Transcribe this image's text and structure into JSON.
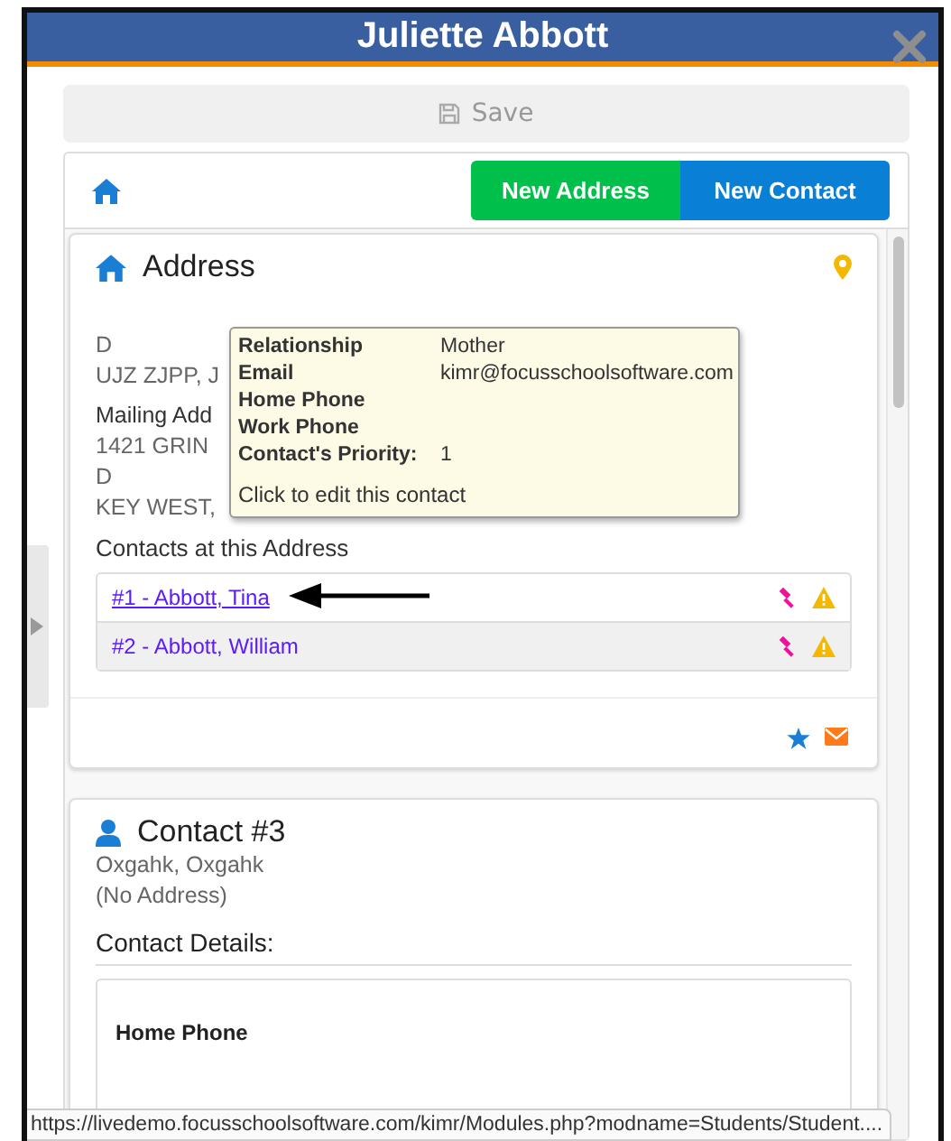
{
  "window": {
    "title": "Juliette Abbott"
  },
  "save_button": {
    "label": "Save",
    "disabled": true
  },
  "toolbar": {
    "buttons": [
      {
        "label": "New Address",
        "kind": "address"
      },
      {
        "label": "New Contact",
        "kind": "contact"
      }
    ]
  },
  "address_card": {
    "title": "Address",
    "lines": [
      {
        "text": "D",
        "kind": "detail"
      },
      {
        "text": "UJZ ZJPP, J",
        "kind": "detail"
      },
      {
        "text": "Mailing Add",
        "kind": "label"
      },
      {
        "text": "1421 GRIN",
        "kind": "detail"
      },
      {
        "text": "D",
        "kind": "detail"
      },
      {
        "text": "KEY WEST,",
        "kind": "detail"
      }
    ],
    "contacts_heading": "Contacts at this Address",
    "contacts": [
      {
        "label": "#1 - Abbott, Tina",
        "hovered": true
      },
      {
        "label": "#2 - Abbott, William",
        "hovered": false
      }
    ]
  },
  "tooltip": {
    "rows": [
      {
        "label": "Relationship",
        "value": "Mother"
      },
      {
        "label": "Email",
        "value": "kimr@focusschoolsoftware.com"
      },
      {
        "label": "Home Phone"
      },
      {
        "label": "Work Phone"
      },
      {
        "label": "Contact's Priority:",
        "value": "1"
      }
    ],
    "footer": "Click to edit this contact"
  },
  "contact_card": {
    "title": "Contact #3",
    "name": "Oxgahk, Oxgahk",
    "address": "(No Address)",
    "details_heading": "Contact Details:",
    "fields": [
      {
        "label": "Home Phone"
      }
    ]
  },
  "status_bar": {
    "url": "https://livedemo.focusschoolsoftware.com/kimr/Modules.php?modname=Students/Student...."
  }
}
